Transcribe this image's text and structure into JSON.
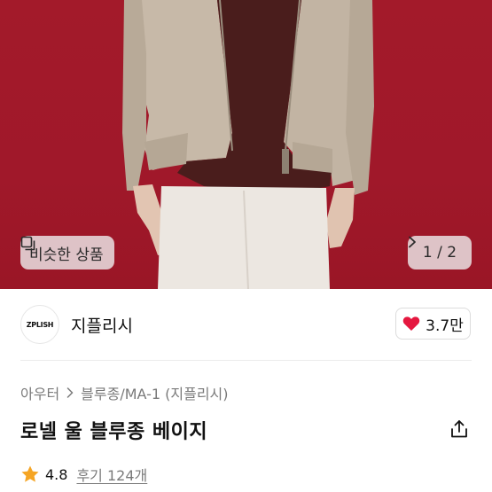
{
  "hero": {
    "similar_button_label": "비슷한 상품",
    "similar_icon": "similar-items-icon",
    "pager_text": "1 / 2",
    "pager_icon": "chevron-right-icon",
    "background_color": "#a31a2a"
  },
  "brand": {
    "logo_text": "ZPLISH",
    "name": "지플리시",
    "like_count": "3.7만",
    "like_icon": "heart-icon",
    "like_color": "#e5173f"
  },
  "breadcrumb": {
    "items": [
      "아우터",
      "블루종/MA-1 (지플리시)"
    ],
    "separator_icon": "chevron-right-icon"
  },
  "product": {
    "title": "로넬 울 블루종 베이지",
    "share_icon": "share-icon"
  },
  "rating": {
    "star_icon": "star-icon",
    "star_color": "#f5a524",
    "score": "4.8",
    "reviews_label": "후기 124개"
  }
}
